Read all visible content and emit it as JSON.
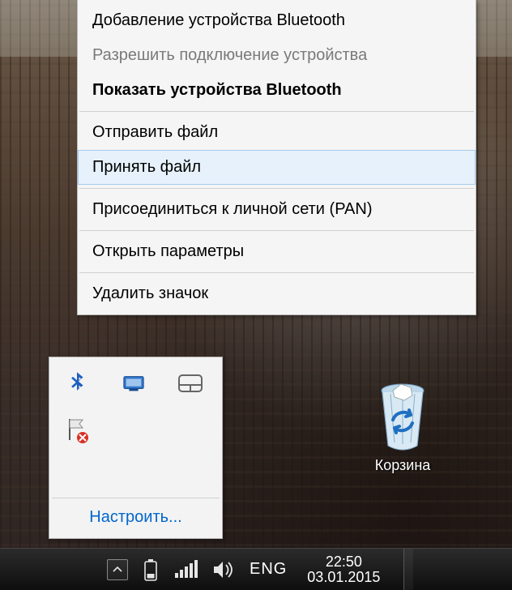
{
  "context_menu": {
    "items": [
      {
        "label": "Добавление устройства Bluetooth",
        "enabled": true,
        "bold": false
      },
      {
        "label": "Разрешить подключение устройства",
        "enabled": false,
        "bold": false
      },
      {
        "label": "Показать устройства Bluetooth",
        "enabled": true,
        "bold": true
      }
    ],
    "items2": [
      {
        "label": "Отправить файл"
      },
      {
        "label": "Принять файл",
        "hover": true
      }
    ],
    "items3": [
      {
        "label": "Присоединиться к личной сети (PAN)"
      }
    ],
    "items4": [
      {
        "label": "Открыть параметры"
      }
    ],
    "items5": [
      {
        "label": "Удалить значок"
      }
    ]
  },
  "tray_flyout": {
    "customize_label": "Настроить..."
  },
  "desktop": {
    "recycle_bin_label": "Корзина"
  },
  "taskbar": {
    "language": "ENG",
    "time": "22:50",
    "date": "03.01.2015"
  }
}
